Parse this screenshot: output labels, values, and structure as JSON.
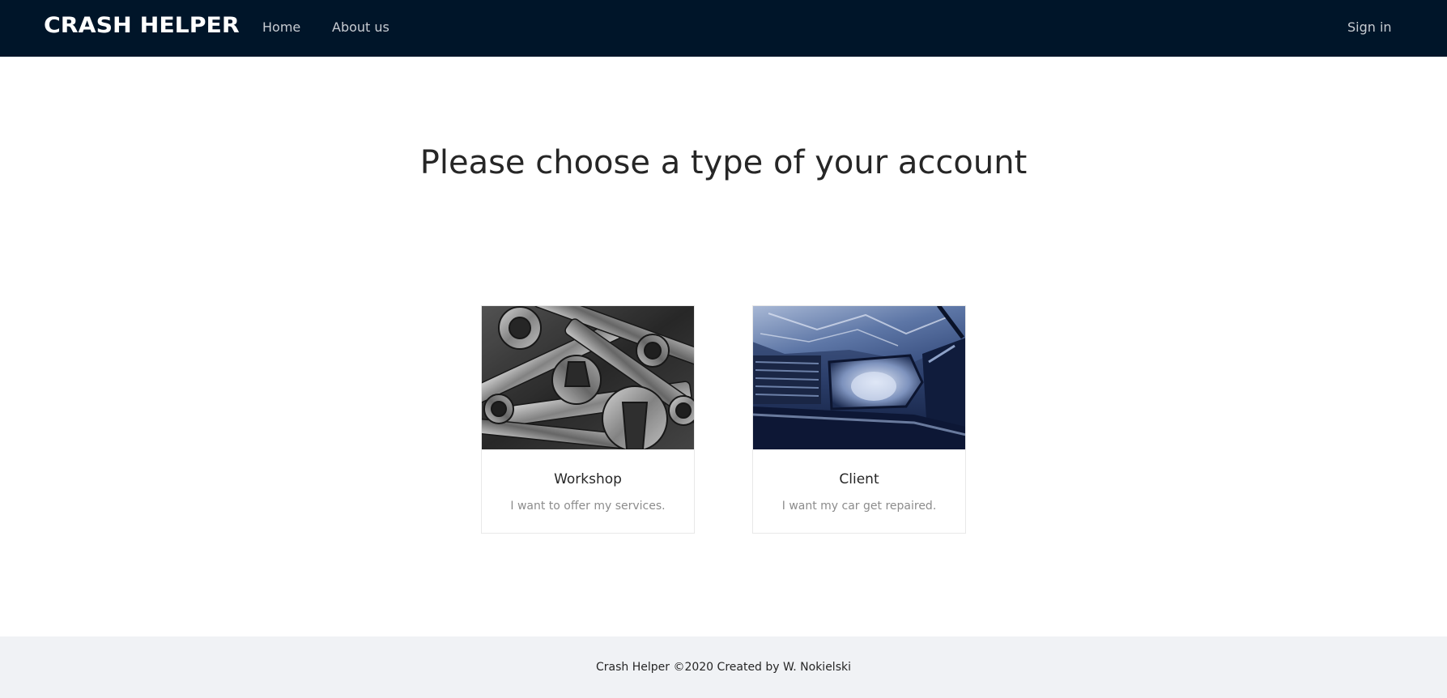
{
  "navbar": {
    "logo": "CRASH HELPER",
    "links": {
      "home": "Home",
      "about": "About us"
    },
    "sign_in": "Sign in",
    "background": "#001529"
  },
  "main": {
    "title": "Please choose a type of your account",
    "cards": {
      "workshop": {
        "title": "Workshop",
        "description": "I want to offer my services.",
        "image_icon": "wrenches-photo"
      },
      "client": {
        "title": "Client",
        "description": "I want my car get repaired.",
        "image_icon": "damaged-car-photo"
      }
    }
  },
  "footer": {
    "text": "Crash Helper ©2020 Created by W. Nokielski"
  }
}
